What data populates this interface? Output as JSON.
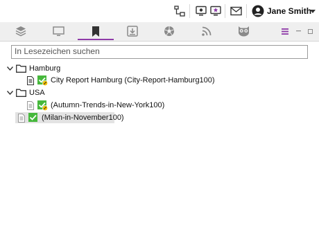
{
  "header": {
    "user_name": "Jane Smith",
    "icons": [
      "network-icon",
      "display-icon",
      "star-slideshow-icon",
      "mail-icon",
      "user-avatar-icon",
      "caret-down-icon"
    ]
  },
  "tabs": {
    "items": [
      "layers-tab",
      "monitor-tab",
      "bookmarks-tab",
      "download-tab",
      "aperture-tab",
      "rss-tab",
      "owl-tab"
    ],
    "active": "bookmarks-tab"
  },
  "search": {
    "placeholder": "In Lesezeichen suchen",
    "value": ""
  },
  "tree": {
    "hamburg": {
      "label": "Hamburg"
    },
    "hamburg_item": {
      "label": "City Report Hamburg (City-Report-Hamburg100)"
    },
    "usa": {
      "label": "USA"
    },
    "usa_item": {
      "label": "(Autumn-Trends-in-New-York100)"
    },
    "root_item": {
      "label": "(Milan-in-November100)"
    }
  },
  "colors": {
    "accent": "#8e3aa8",
    "check_green": "#46b83c",
    "badge_yellow": "#f5c000"
  }
}
